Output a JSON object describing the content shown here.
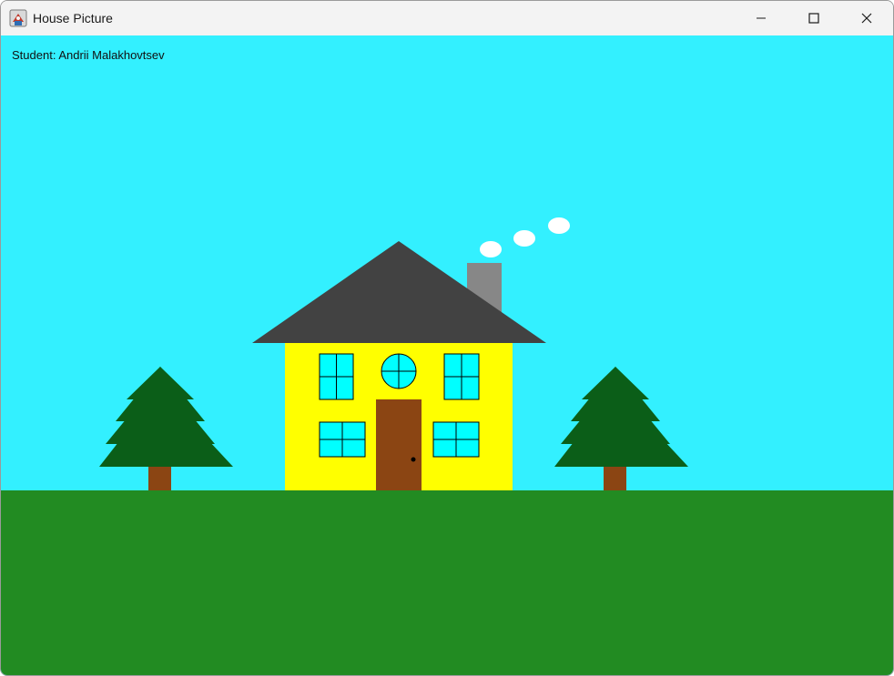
{
  "window": {
    "title": "House Picture",
    "app_icon": "java-app-icon",
    "controls": {
      "minimize_icon": "minimize-icon",
      "maximize_icon": "maximize-icon",
      "close_icon": "close-icon"
    }
  },
  "canvas": {
    "student_label": "Student: Andrii Malakhovtsev"
  },
  "colors": {
    "sky": "#33f0ff",
    "grass": "#228b22",
    "house_wall": "#ffff00",
    "roof": "#424242",
    "chimney": "#878787",
    "smoke": "#ffffff",
    "door": "#8b4513",
    "window_glass": "#00ffff",
    "tree_foliage": "#0b5e18",
    "tree_trunk": "#8b4513"
  }
}
